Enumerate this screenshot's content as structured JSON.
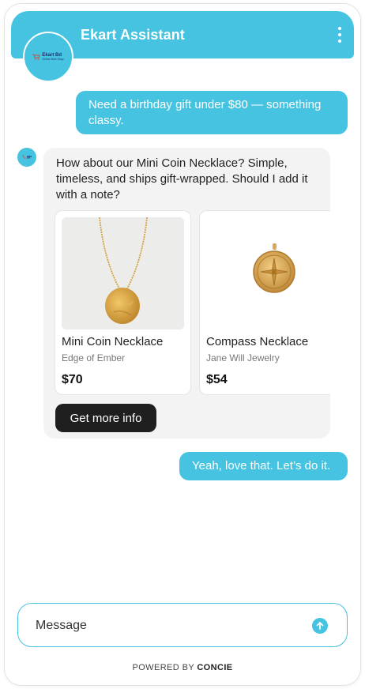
{
  "header": {
    "title": "Ekart Assistant",
    "menu_icon": "kebab-menu-icon"
  },
  "brand": {
    "logo_name": "Ekart Bd",
    "logo_tag": "Online Best Shop",
    "accent": "#45c3e0"
  },
  "messages": {
    "user_1": "Need a birthday gift under $80 — something classy.",
    "bot_1": "How about our Mini Coin Necklace? Simple, timeless, and ships gift-wrapped. Should I add it with a note?",
    "user_2": "Yeah, love that. Let’s do it."
  },
  "products": [
    {
      "name": "Mini Coin Necklace",
      "brand": "Edge of Ember",
      "price": "$70",
      "image": "gold-coin-necklace"
    },
    {
      "name": "Compass Necklace",
      "brand": "Jane Will Jewelry",
      "price": "$54",
      "image": "gold-compass-pendant"
    }
  ],
  "more_info_button": "Get more info",
  "composer": {
    "placeholder": "Message",
    "send_icon": "arrow-up-icon"
  },
  "footer": {
    "powered_prefix": "POWERED BY",
    "powered_brand": "CONCIE"
  }
}
